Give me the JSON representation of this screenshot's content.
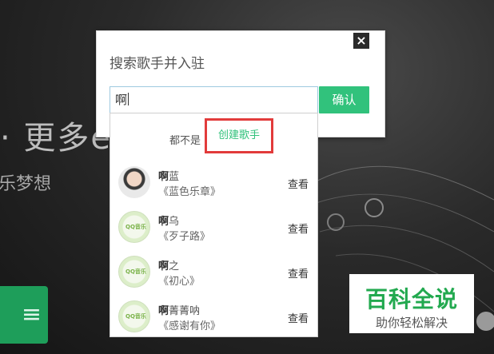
{
  "background": {
    "headline": "· 更多e",
    "subline": "乐梦想",
    "green_button_glyph": "≡"
  },
  "dialog": {
    "title": "搜索歌手并入驻",
    "close_icon": "×",
    "search_value": "啊",
    "confirm_label": "确认"
  },
  "dropdown": {
    "not_found_text": "都不是",
    "create_label": "创建歌手",
    "results": [
      {
        "singer_bold": "啊",
        "singer_rest": "蓝",
        "song": "《蓝色乐章》",
        "view": "查看",
        "avatar": "photo"
      },
      {
        "singer_bold": "啊",
        "singer_rest": "乌",
        "song": "《歹子路》",
        "view": "查看",
        "avatar": "default"
      },
      {
        "singer_bold": "啊",
        "singer_rest": "之",
        "song": "《初心》",
        "view": "查看",
        "avatar": "default"
      },
      {
        "singer_bold": "啊",
        "singer_rest": "菁菁呐",
        "song": "《感谢有你》",
        "view": "查看",
        "avatar": "default"
      }
    ],
    "avatar_logo": "QQ音乐"
  },
  "watermark": {
    "title": "百科全说",
    "subtitle": "助你轻松解决"
  },
  "colors": {
    "accent_green": "#31c27c",
    "highlight_red": "#e23b3b"
  }
}
